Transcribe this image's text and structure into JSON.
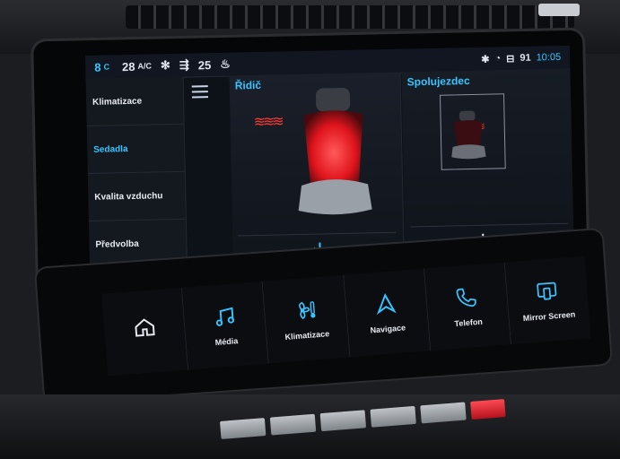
{
  "status_bar": {
    "temp_left": "8",
    "temp_left_unit": "C",
    "temp_main": "28",
    "ac_label": "A/C",
    "temp_right": "25",
    "extra": "91",
    "time": "10:05"
  },
  "sidebar": {
    "items": [
      {
        "label": "Klimatizace"
      },
      {
        "label": "Sedadla"
      },
      {
        "label": "Kvalita vzduchu"
      },
      {
        "label": "Předvolba"
      }
    ]
  },
  "driver_panel": {
    "title": "Řidič",
    "heat_level": 3
  },
  "passenger_panel": {
    "title": "Spolujezdec",
    "heat_level": 3
  },
  "touchbar": {
    "items": [
      {
        "label": ""
      },
      {
        "label": "Média"
      },
      {
        "label": "Klimatizace"
      },
      {
        "label": "Navigace"
      },
      {
        "label": "Telefon"
      },
      {
        "label": "Mirror Screen"
      }
    ]
  },
  "colors": {
    "accent": "#37c5ff",
    "heat": "#ff3b30",
    "background": "#0d1118"
  }
}
